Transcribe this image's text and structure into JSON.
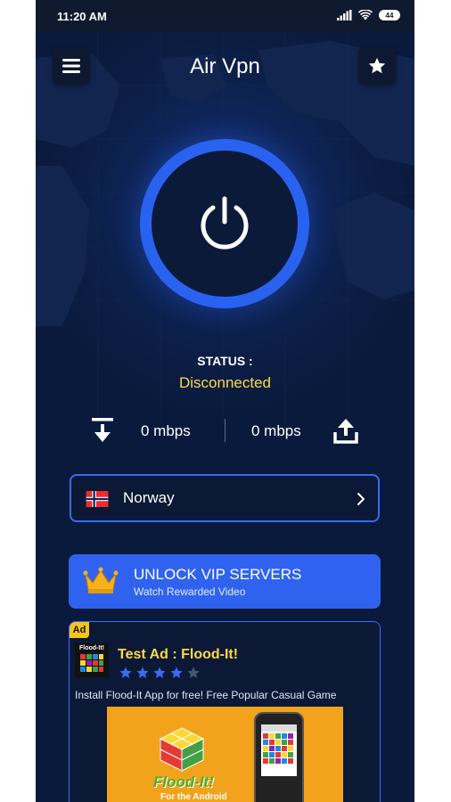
{
  "status_bar": {
    "time": "11:20 AM",
    "battery": "44"
  },
  "header": {
    "title": "Air Vpn",
    "menu_icon": "hamburger-menu-icon",
    "favorite_icon": "star-icon"
  },
  "power": {
    "icon": "power-icon",
    "ring_color": "#2a62f0"
  },
  "connection": {
    "status_label": "STATUS :",
    "status_value": "Disconnected",
    "status_color": "#ffd84a",
    "download_speed": "0 mbps",
    "upload_speed": "0 mbps"
  },
  "server": {
    "country": "Norway",
    "flag_icon": "norway-flag-icon"
  },
  "vip": {
    "title": "UNLOCK VIP SERVERS",
    "subtitle": "Watch Rewarded Video",
    "icon": "crown-icon"
  },
  "ad": {
    "badge": "Ad",
    "icon_text": "Flood-It!",
    "title": "Test Ad : Flood-It!",
    "rating": 4,
    "rating_max": 5,
    "description": "Install Flood-It App for free! Free Popular Casual Game",
    "banner_title": "Flood-It!",
    "banner_subtitle": "For the Android"
  },
  "colors": {
    "background": "#0a1a3c",
    "accent": "#2f63ef",
    "highlight": "#ffd84a"
  }
}
